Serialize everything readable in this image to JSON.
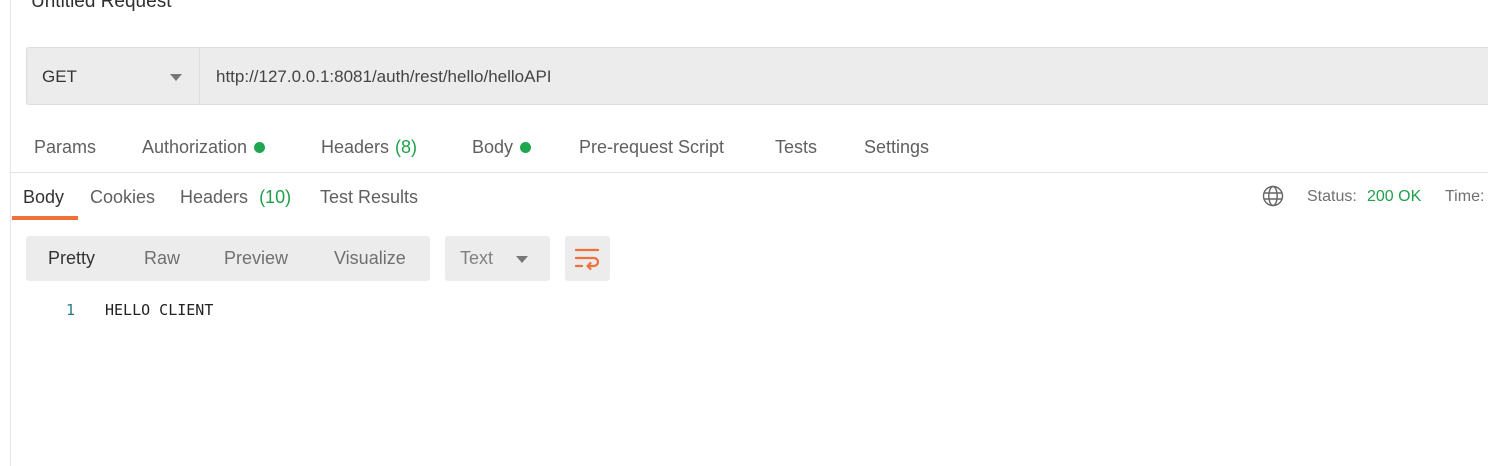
{
  "request": {
    "title": "Untitled Request",
    "method": "GET",
    "url": "http://127.0.0.1:8081/auth/rest/hello/helloAPI"
  },
  "request_tabs": [
    {
      "label": "Params",
      "count": null,
      "dot": false
    },
    {
      "label": "Authorization",
      "count": null,
      "dot": true
    },
    {
      "label": "Headers",
      "count": "(8)",
      "dot": false
    },
    {
      "label": "Body",
      "count": null,
      "dot": true
    },
    {
      "label": "Pre-request Script",
      "count": null,
      "dot": false
    },
    {
      "label": "Tests",
      "count": null,
      "dot": false
    },
    {
      "label": "Settings",
      "count": null,
      "dot": false
    }
  ],
  "response_tabs": [
    {
      "label": "Body",
      "count": null,
      "active": true
    },
    {
      "label": "Cookies",
      "count": null,
      "active": false
    },
    {
      "label": "Headers",
      "count": "(10)",
      "active": false
    },
    {
      "label": "Test Results",
      "count": null,
      "active": false
    }
  ],
  "status": {
    "icon": "globe-icon",
    "label": "Status:",
    "value": "200 OK",
    "time_label": "Time:"
  },
  "view_modes": [
    {
      "label": "Pretty",
      "selected": true
    },
    {
      "label": "Raw",
      "selected": false
    },
    {
      "label": "Preview",
      "selected": false
    },
    {
      "label": "Visualize",
      "selected": false
    }
  ],
  "format": {
    "selected": "Text"
  },
  "wrap_icon": "wrap-lines-icon",
  "response_body": {
    "lines": [
      {
        "number": "1",
        "text": "HELLO CLIENT"
      }
    ]
  },
  "colors": {
    "accent": "#f0703a",
    "success": "#20a04a",
    "dot": "#1fa650"
  }
}
